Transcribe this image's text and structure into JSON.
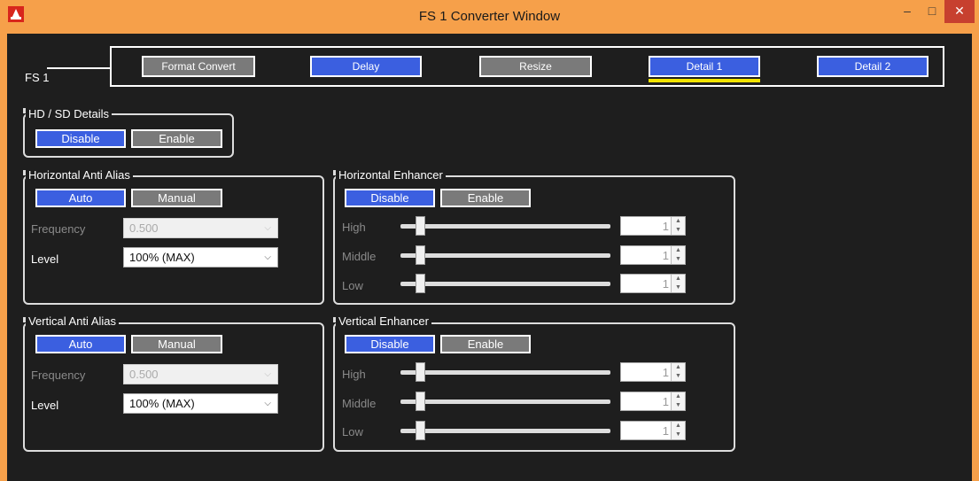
{
  "window": {
    "title": "FS 1 Converter Window",
    "minimize": "–",
    "maximize": "□",
    "close": "✕"
  },
  "fs_label": "FS 1",
  "nav": [
    {
      "label": "Format Convert",
      "active": false
    },
    {
      "label": "Delay",
      "active": true
    },
    {
      "label": "Resize",
      "active": false
    },
    {
      "label": "Detail 1",
      "active": true,
      "selected": true
    },
    {
      "label": "Detail 2",
      "active": true
    }
  ],
  "hdsd": {
    "title": "HD / SD Details",
    "disable": "Disable",
    "enable": "Enable"
  },
  "h_anti_alias": {
    "title": "Horizontal Anti Alias",
    "auto": "Auto",
    "manual": "Manual",
    "frequency_label": "Frequency",
    "frequency_value": "0.500",
    "level_label": "Level",
    "level_value": "100% (MAX)"
  },
  "v_anti_alias": {
    "title": "Vertical Anti Alias",
    "auto": "Auto",
    "manual": "Manual",
    "frequency_label": "Frequency",
    "frequency_value": "0.500",
    "level_label": "Level",
    "level_value": "100% (MAX)"
  },
  "h_enhancer": {
    "title": "Horizontal Enhancer",
    "disable": "Disable",
    "enable": "Enable",
    "rows": [
      {
        "label": "High",
        "value": "1"
      },
      {
        "label": "Middle",
        "value": "1"
      },
      {
        "label": "Low",
        "value": "1"
      }
    ]
  },
  "v_enhancer": {
    "title": "Vertical Enhancer",
    "disable": "Disable",
    "enable": "Enable",
    "rows": [
      {
        "label": "High",
        "value": "1"
      },
      {
        "label": "Middle",
        "value": "1"
      },
      {
        "label": "Low",
        "value": "1"
      }
    ]
  },
  "colors": {
    "accent_blue": "#3b5fe0",
    "inactive_gray": "#7a7a7a",
    "selected_underline": "#f2e300",
    "titlebar": "#f6a04a",
    "background": "#1e1e1e",
    "close_red": "#c7402f"
  },
  "icons": {
    "app": "app-logo-icon",
    "dropdown": "chevron-down-icon",
    "spin": "spin-arrows-icon"
  }
}
